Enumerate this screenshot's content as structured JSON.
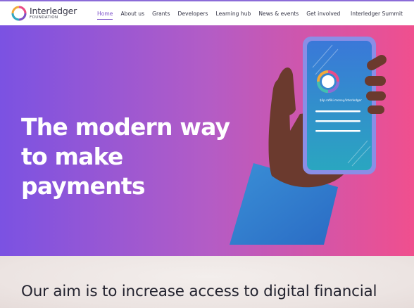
{
  "brand": {
    "name": "Interledger",
    "subtitle": "FOUNDATION"
  },
  "nav": {
    "items": [
      {
        "label": "Home",
        "active": true
      },
      {
        "label": "About us",
        "active": false
      },
      {
        "label": "Grants",
        "active": false
      },
      {
        "label": "Developers",
        "active": false
      },
      {
        "label": "Learning hub",
        "active": false
      },
      {
        "label": "News & events",
        "active": false
      },
      {
        "label": "Get involved",
        "active": false
      }
    ],
    "summit_label": "Interledger Summit"
  },
  "hero": {
    "title": "The modern way to make payments",
    "payment_pointer": "$ilp.rafiki.money/interledger"
  },
  "about": {
    "aim_text": "Our aim is to increase access to digital financial"
  },
  "colors": {
    "accent": "#7b4fc9",
    "hero_gradient_start": "#7b52e2",
    "hero_gradient_end": "#f04f8e"
  }
}
